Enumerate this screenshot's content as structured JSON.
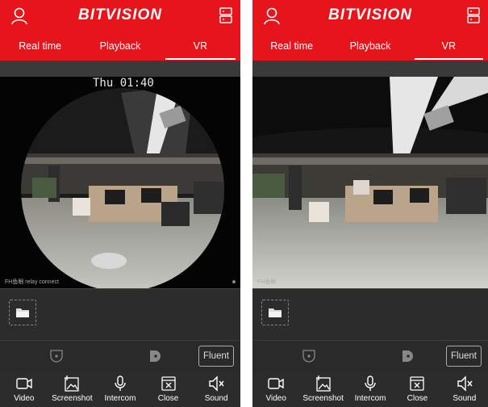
{
  "app": {
    "logo": "BITVISION"
  },
  "tabs": [
    {
      "label": "Real time"
    },
    {
      "label": "Playback"
    },
    {
      "label": "VR"
    }
  ],
  "active_tab": "VR",
  "video": {
    "timestamp": "Thu 01:40",
    "watermark_left": "FH鱼眼 relay connect",
    "watermark_right": "FH鱼眼"
  },
  "quality": {
    "label": "Fluent"
  },
  "toolbar": [
    {
      "label": "Video",
      "icon": "video-icon"
    },
    {
      "label": "Screenshot",
      "icon": "screenshot-icon"
    },
    {
      "label": "Intercom",
      "icon": "microphone-icon"
    },
    {
      "label": "Close",
      "icon": "close-icon"
    },
    {
      "label": "Sound",
      "icon": "sound-muted-icon"
    }
  ],
  "colors": {
    "brand": "#e8141c",
    "panel": "#2c2c2c"
  }
}
